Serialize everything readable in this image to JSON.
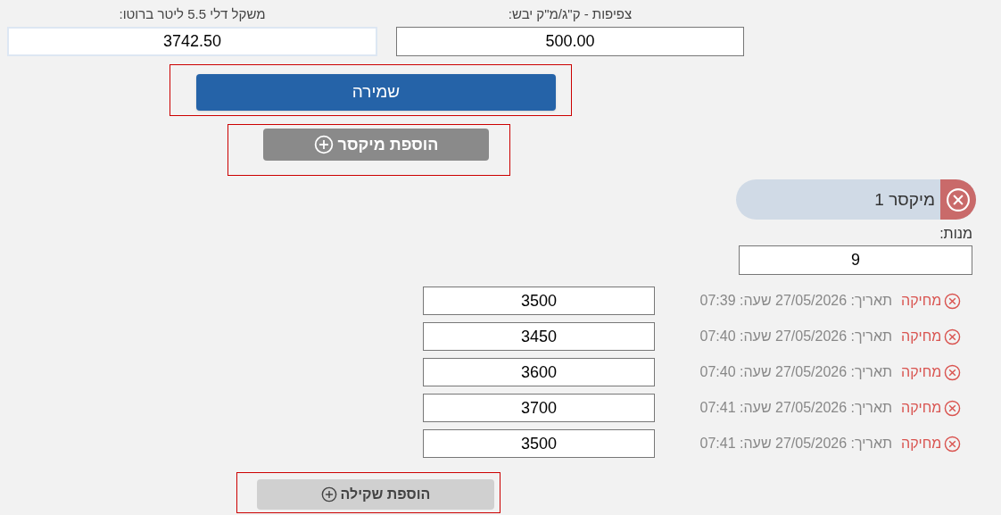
{
  "fields": [
    {
      "label": "צפיפות - ק\"ג/מ\"ק יבש:",
      "value": "500.00",
      "focused": false
    },
    {
      "label": "משקל דלי 5.5 ליטר ברוטו:",
      "value": "3742.50",
      "focused": true
    }
  ],
  "save_button": {
    "label": "שמירה"
  },
  "add_mixer_button": {
    "label": "הוספת מיקסר"
  },
  "mixer": {
    "title": "מיקסר 1",
    "portions_label": "מנות:",
    "portions_value": "9",
    "weighings": [
      {
        "value": "3500",
        "info": "תאריך: 27/05/2026 שעה: 07:39",
        "delete_label": "מחיקה"
      },
      {
        "value": "3450",
        "info": "תאריך: 27/05/2026 שעה: 07:40",
        "delete_label": "מחיקה"
      },
      {
        "value": "3600",
        "info": "תאריך: 27/05/2026 שעה: 07:40",
        "delete_label": "מחיקה"
      },
      {
        "value": "3700",
        "info": "תאריך: 27/05/2026 שעה: 07:41",
        "delete_label": "מחיקה"
      },
      {
        "value": "3500",
        "info": "תאריך: 27/05/2026 שעה: 07:41",
        "delete_label": "מחיקה"
      }
    ],
    "add_weighing_button": {
      "label": "הוספת שקילה"
    }
  }
}
